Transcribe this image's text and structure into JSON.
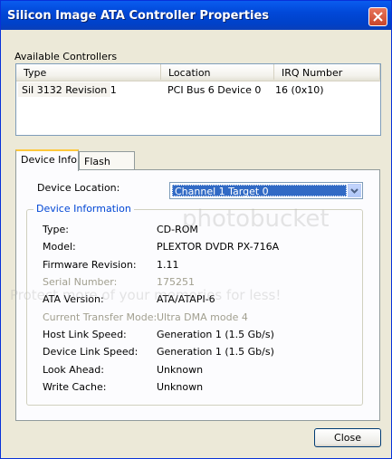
{
  "window": {
    "title": "Silicon Image ATA Controller Properties"
  },
  "controllers": {
    "group_label": "Available Controllers",
    "columns": [
      "Type",
      "Location",
      "IRQ Number"
    ],
    "rows": [
      {
        "type": "SiI 3132 Revision 1",
        "location": "PCI Bus 6 Device 0",
        "irq": "16 (0x10)"
      }
    ]
  },
  "tabs": [
    {
      "label": "Device Info",
      "active": true
    },
    {
      "label": "Flash BIOS",
      "active": false
    }
  ],
  "device_location": {
    "label": "Device Location:",
    "selected": "Channel 1   Target 0"
  },
  "device_information": {
    "title": "Device Information",
    "rows": [
      {
        "label": "Type:",
        "value": "CD-ROM",
        "disabled": false
      },
      {
        "label": "Model:",
        "value": "PLEXTOR DVDR   PX-716A",
        "disabled": false
      },
      {
        "label": "Firmware Revision:",
        "value": "1.11",
        "disabled": false
      },
      {
        "label": "Serial Number:",
        "value": "175251",
        "disabled": true
      },
      {
        "label": "ATA Version:",
        "value": "ATA/ATAPI-6",
        "disabled": false
      },
      {
        "label": "Current Transfer Mode:",
        "value": "Ultra DMA mode 4",
        "disabled": true
      },
      {
        "label": "Host Link Speed:",
        "value": "Generation 1 (1.5 Gb/s)",
        "disabled": false
      },
      {
        "label": "Device Link Speed:",
        "value": "Generation 1 (1.5 Gb/s)",
        "disabled": false
      },
      {
        "label": "Look Ahead:",
        "value": "Unknown",
        "disabled": false
      },
      {
        "label": "Write Cache:",
        "value": "Unknown",
        "disabled": false
      }
    ]
  },
  "buttons": {
    "close": "Close"
  },
  "watermark": {
    "brand": "photobucket",
    "tagline": "Protect more of your memories for less!"
  }
}
